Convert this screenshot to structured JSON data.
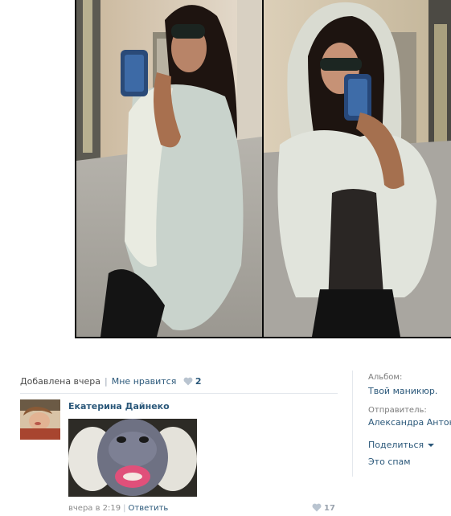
{
  "post": {
    "added_label": "Добавлена вчера",
    "like_label": "Мне нравится",
    "like_count": "2"
  },
  "comment": {
    "author": "Екатерина Дайнеко",
    "time": "вчера в 2:19",
    "reply_label": "Ответить",
    "like_count": "17"
  },
  "sidebar": {
    "album_label": "Альбом:",
    "album_name": "Твой маникюр.",
    "sender_label": "Отправитель:",
    "sender_name": "Александра Антонова",
    "share_label": "Поделиться",
    "spam_label": "Это спам"
  },
  "colors": {
    "link": "#2b587a",
    "heart": "#b9c4d0"
  },
  "icons": {
    "like": "heart-icon",
    "share_dropdown": "chevron-down-icon"
  }
}
